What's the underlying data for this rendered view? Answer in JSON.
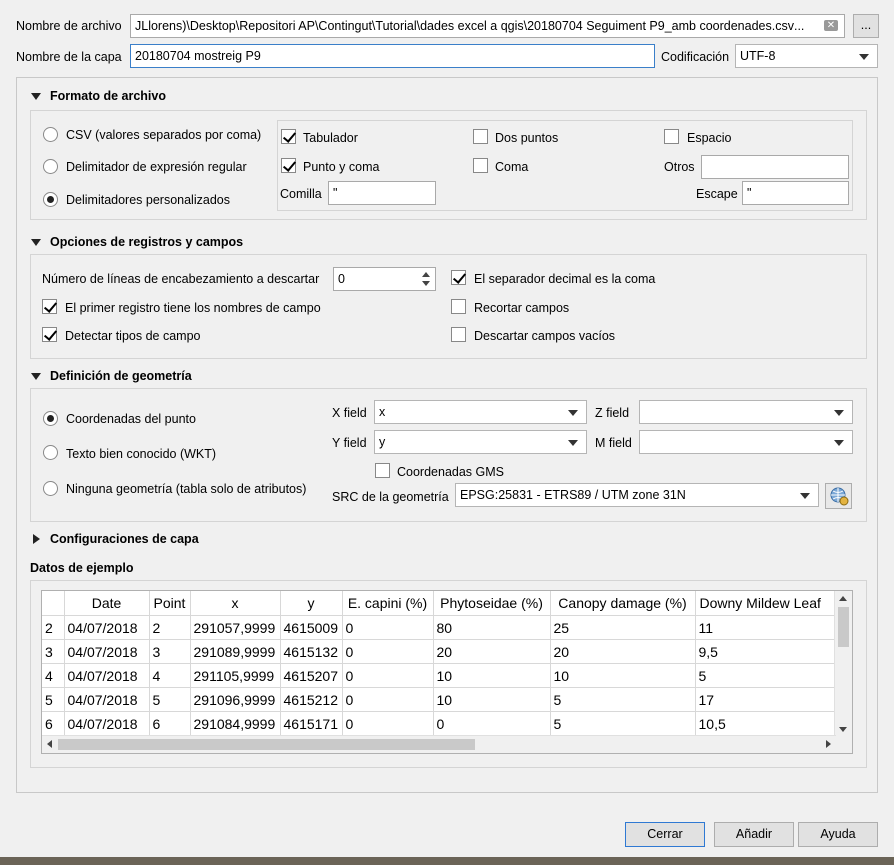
{
  "top": {
    "file_label": "Nombre de archivo",
    "file_path": "...JLlorens)\\Desktop\\Repositori AP\\Contingut\\Tutorial\\dades excel a qgis\\20180704 Seguiment P9_amb coordenades.csv",
    "browse_label": "...",
    "layer_label": "Nombre de la capa",
    "layer_name": "20180704 mostreig P9",
    "encoding_label": "Codificación",
    "encoding_value": "UTF-8"
  },
  "file_format": {
    "title": "Formato de archivo",
    "radios": [
      {
        "label": "CSV (valores separados por coma)",
        "checked": false
      },
      {
        "label": "Delimitador de expresión regular",
        "checked": false
      },
      {
        "label": "Delimitadores personalizados",
        "checked": true
      }
    ],
    "delims": {
      "tab": {
        "label": "Tabulador",
        "checked": true
      },
      "colon": {
        "label": "Dos puntos",
        "checked": false
      },
      "space": {
        "label": "Espacio",
        "checked": false
      },
      "semicolon": {
        "label": "Punto y coma",
        "checked": true
      },
      "comma": {
        "label": "Coma",
        "checked": false
      },
      "others_label": "Otros",
      "others_value": "",
      "quote_label": "Comilla",
      "quote_value": "\"",
      "escape_label": "Escape",
      "escape_value": "\""
    }
  },
  "records": {
    "title": "Opciones de registros y campos",
    "skip_lines_label": "Número de líneas de encabezamiento a descartar",
    "skip_lines_value": "0",
    "first_record_names": {
      "label": "El primer registro tiene los nombres de campo",
      "checked": true
    },
    "detect_types": {
      "label": "Detectar tipos de campo",
      "checked": true
    },
    "decimal_comma": {
      "label": "El separador decimal es la coma",
      "checked": true
    },
    "trim_fields": {
      "label": "Recortar campos",
      "checked": false
    },
    "discard_empty": {
      "label": "Descartar campos vacíos",
      "checked": false
    }
  },
  "geometry": {
    "title": "Definición de geometría",
    "radios": [
      {
        "label": "Coordenadas del punto",
        "checked": true
      },
      {
        "label": "Texto bien conocido (WKT)",
        "checked": false
      },
      {
        "label": "Ninguna geometría (tabla solo de atributos)",
        "checked": false
      }
    ],
    "x_field_label": "X field",
    "x_field_value": "x",
    "y_field_label": "Y field",
    "y_field_value": "y",
    "z_field_label": "Z field",
    "z_field_value": "",
    "m_field_label": "M field",
    "m_field_value": "",
    "dms": {
      "label": "Coordenadas GMS",
      "checked": false
    },
    "crs_label": "SRC de la geometría",
    "crs_value": "EPSG:25831 - ETRS89 / UTM zone 31N"
  },
  "layer_settings": {
    "title": "Configuraciones de capa"
  },
  "sample": {
    "title": "Datos de ejemplo",
    "headers": [
      "Date",
      "Point",
      "x",
      "y",
      "E. capini (%)",
      "Phytoseidae (%)",
      "Canopy damage (%)",
      "Downy Mildew Leaf"
    ],
    "rows": [
      {
        "num": "2",
        "cells": [
          "04/07/2018",
          "2",
          "291057,9999",
          "4615009",
          "0",
          "80",
          "25",
          "11"
        ]
      },
      {
        "num": "3",
        "cells": [
          "04/07/2018",
          "3",
          "291089,9999",
          "4615132",
          "0",
          "20",
          "20",
          "9,5"
        ]
      },
      {
        "num": "4",
        "cells": [
          "04/07/2018",
          "4",
          "291105,9999",
          "4615207",
          "0",
          "10",
          "10",
          "5"
        ]
      },
      {
        "num": "5",
        "cells": [
          "04/07/2018",
          "5",
          "291096,9999",
          "4615212",
          "0",
          "10",
          "5",
          "17"
        ]
      },
      {
        "num": "6",
        "cells": [
          "04/07/2018",
          "6",
          "291084,9999",
          "4615171",
          "0",
          "0",
          "5",
          "10,5"
        ]
      }
    ]
  },
  "buttons": {
    "close": "Cerrar",
    "add": "Añadir",
    "help": "Ayuda"
  }
}
